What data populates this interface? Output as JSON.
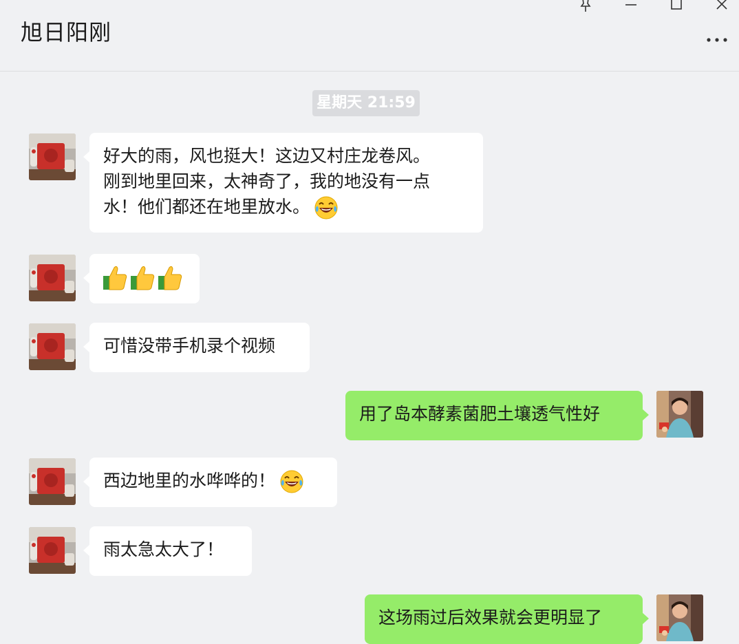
{
  "window": {
    "title": "旭日阳刚",
    "controls": [
      "pin-icon",
      "minimize-icon",
      "maximize-icon",
      "close-icon"
    ],
    "more_icon": "more-icon"
  },
  "chat": {
    "timestamp": "星期天 21:59",
    "colors": {
      "incoming_bubble": "#ffffff",
      "outgoing_bubble": "#95ec69",
      "background": "#f0f1f3"
    },
    "messages": [
      {
        "direction": "incoming",
        "lines": [
          "好大的雨，风也挺大！这边又村庄龙卷风。",
          "刚到地里回来，太神奇了，我的地没有一点",
          "水！他们都还在地里放水。"
        ],
        "emoji": "tears-of-joy-emoji"
      },
      {
        "direction": "incoming",
        "emojis": [
          "thumbs-up-emoji",
          "thumbs-up-emoji",
          "thumbs-up-emoji"
        ]
      },
      {
        "direction": "incoming",
        "text": "可惜没带手机录个视频"
      },
      {
        "direction": "outgoing",
        "text": "用了岛本酵素菌肥土壤透气性好"
      },
      {
        "direction": "incoming",
        "text": "西边地里的水哗哗的！",
        "emoji": "tears-of-joy-emoji"
      },
      {
        "direction": "incoming",
        "text": "雨太急太大了！"
      },
      {
        "direction": "outgoing",
        "text": "这场雨过后效果就会更明显了"
      }
    ]
  }
}
